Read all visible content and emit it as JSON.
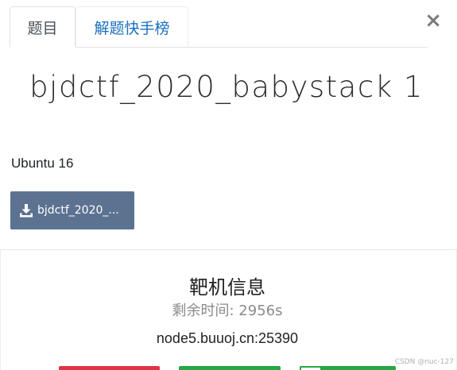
{
  "tabs": [
    {
      "label": "题目",
      "active": true
    },
    {
      "label": "解题快手榜",
      "active": false
    }
  ],
  "close_label": "×",
  "challenge": {
    "title": "bjdctf_2020_babystack 1",
    "description": "Ubuntu 16",
    "download_label": "bjdctf_2020_..."
  },
  "instance": {
    "title": "靶机信息",
    "remaining": "剩余时间: 2956s",
    "address": "node5.buuoj.cn:25390"
  },
  "watermark": "CSDN @nuc-127",
  "colors": {
    "tab_link": "#1a6fbf",
    "download_button": "#5c7291",
    "destroy_button": "#dc3545",
    "renew_button": "#28a745",
    "submit_button": "#28a745"
  },
  "icons": {
    "download": "download-icon"
  }
}
